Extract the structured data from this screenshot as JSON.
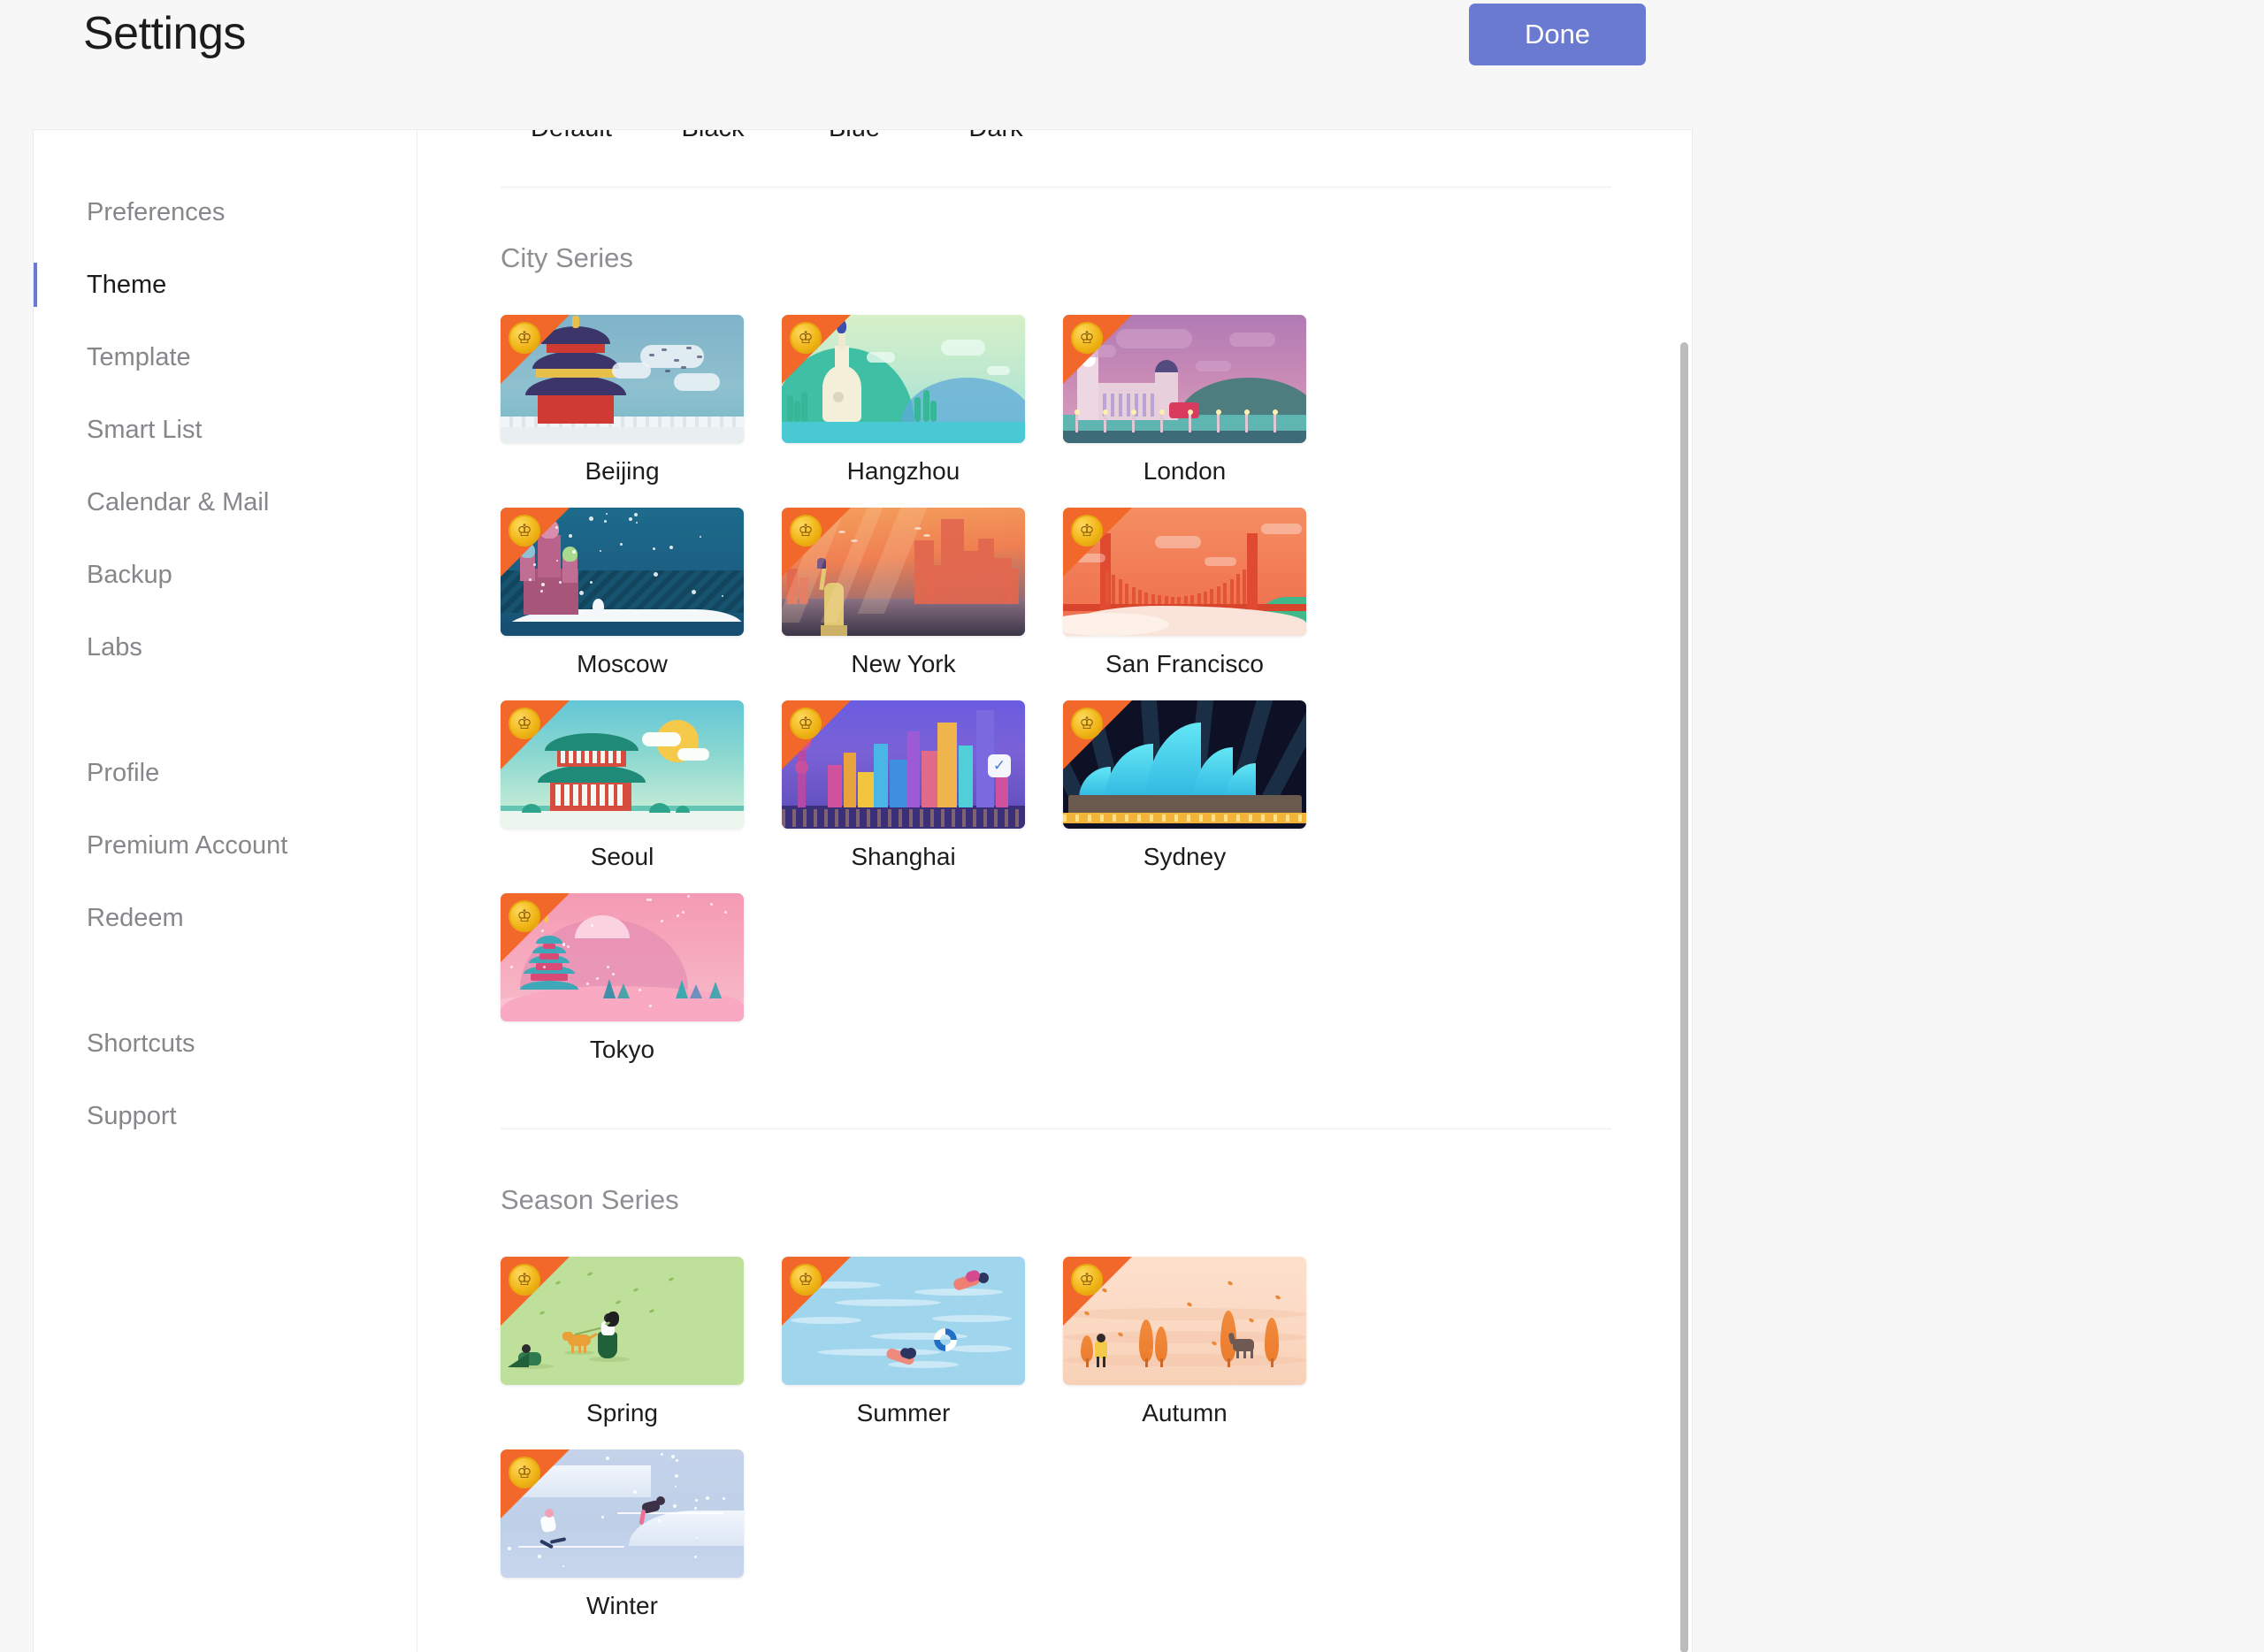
{
  "header": {
    "title": "Settings",
    "done_label": "Done",
    "done_color": "#6b7ad1"
  },
  "sidebar": {
    "groups": [
      {
        "items": [
          {
            "label": "Preferences",
            "active": false
          },
          {
            "label": "Theme",
            "active": true
          },
          {
            "label": "Template",
            "active": false
          },
          {
            "label": "Smart List",
            "active": false
          },
          {
            "label": "Calendar & Mail",
            "active": false
          },
          {
            "label": "Backup",
            "active": false
          },
          {
            "label": "Labs",
            "active": false
          }
        ]
      },
      {
        "items": [
          {
            "label": "Profile",
            "active": false
          },
          {
            "label": "Premium Account",
            "active": false
          },
          {
            "label": "Redeem",
            "active": false
          }
        ]
      },
      {
        "items": [
          {
            "label": "Shortcuts",
            "active": false
          },
          {
            "label": "Support",
            "active": false
          }
        ]
      }
    ]
  },
  "content": {
    "basic_theme_tabs": [
      "Default",
      "Black",
      "Blue",
      "Dark"
    ],
    "sections": [
      {
        "title": "City Series",
        "themes": [
          {
            "label": "Beijing",
            "premium": true,
            "scene": "bj"
          },
          {
            "label": "Hangzhou",
            "premium": true,
            "scene": "hz"
          },
          {
            "label": "London",
            "premium": true,
            "scene": "ld"
          },
          {
            "label": "Moscow",
            "premium": true,
            "scene": "mc"
          },
          {
            "label": "New York",
            "premium": true,
            "scene": "ny"
          },
          {
            "label": "San Francisco",
            "premium": true,
            "scene": "sf"
          },
          {
            "label": "Seoul",
            "premium": true,
            "scene": "se"
          },
          {
            "label": "Shanghai",
            "premium": true,
            "scene": "sg"
          },
          {
            "label": "Sydney",
            "premium": true,
            "scene": "sy"
          },
          {
            "label": "Tokyo",
            "premium": true,
            "scene": "tk"
          }
        ]
      },
      {
        "title": "Season Series",
        "themes": [
          {
            "label": "Spring",
            "premium": true,
            "scene": "sp"
          },
          {
            "label": "Summer",
            "premium": true,
            "scene": "sm"
          },
          {
            "label": "Autumn",
            "premium": true,
            "scene": "at"
          },
          {
            "label": "Winter",
            "premium": true,
            "scene": "wt"
          }
        ]
      }
    ],
    "premium_badge_icon": "crown-icon",
    "premium_badge_glyph": "♔",
    "premium_badge_corner_color": "#f2682a"
  }
}
